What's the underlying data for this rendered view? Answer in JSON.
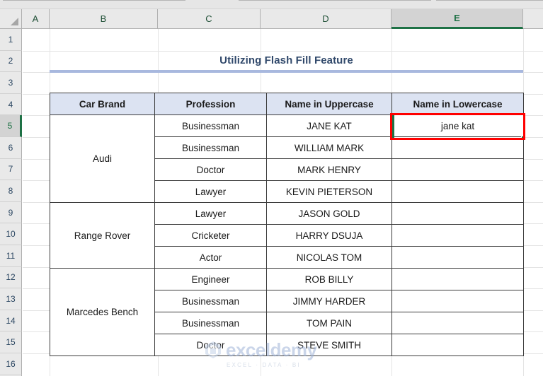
{
  "app": {
    "type": "spreadsheet",
    "accent_green": "#1e7145",
    "annotation_color": "#ff0000",
    "header_fill": "#dce3f2",
    "title_color": "#31496b",
    "title_rule_color": "#a8b8de"
  },
  "grid": {
    "column_headers": [
      "A",
      "B",
      "C",
      "D",
      "E"
    ],
    "selected_column": "E",
    "row_headers": [
      "1",
      "2",
      "3",
      "4",
      "5",
      "6",
      "7",
      "8",
      "9",
      "10",
      "11",
      "12",
      "13",
      "14",
      "15",
      "16"
    ],
    "selected_row": "5",
    "active_cell": "E5"
  },
  "title": {
    "text": "Utilizing Flash Fill Feature"
  },
  "table": {
    "headers": [
      "Car Brand",
      "Profession",
      "Name in Uppercase",
      "Name in Lowercase"
    ],
    "brands": [
      {
        "name": "Audi",
        "rows": 4
      },
      {
        "name": "Range Rover",
        "rows": 3
      },
      {
        "name": "Marcedes Bench",
        "rows": 4
      }
    ],
    "rows": [
      {
        "profession": "Businessman",
        "uppercase": "JANE KAT",
        "lowercase": "jane kat"
      },
      {
        "profession": "Businessman",
        "uppercase": "WILLIAM MARK",
        "lowercase": ""
      },
      {
        "profession": "Doctor",
        "uppercase": "MARK HENRY",
        "lowercase": ""
      },
      {
        "profession": "Lawyer",
        "uppercase": "KEVIN PIETERSON",
        "lowercase": ""
      },
      {
        "profession": "Lawyer",
        "uppercase": "JASON GOLD",
        "lowercase": ""
      },
      {
        "profession": "Cricketer",
        "uppercase": "HARRY DSUJA",
        "lowercase": ""
      },
      {
        "profession": "Actor",
        "uppercase": "NICOLAS TOM",
        "lowercase": ""
      },
      {
        "profession": "Engineer",
        "uppercase": "ROB BILLY",
        "lowercase": ""
      },
      {
        "profession": "Businessman",
        "uppercase": "JIMMY HARDER",
        "lowercase": ""
      },
      {
        "profession": "Businessman",
        "uppercase": "TOM PAIN",
        "lowercase": ""
      },
      {
        "profession": "Doctor",
        "uppercase": "STEVE SMITH",
        "lowercase": ""
      }
    ]
  },
  "watermark": {
    "brand": "exceldemy",
    "tagline": "EXCEL · DATA · BI"
  }
}
